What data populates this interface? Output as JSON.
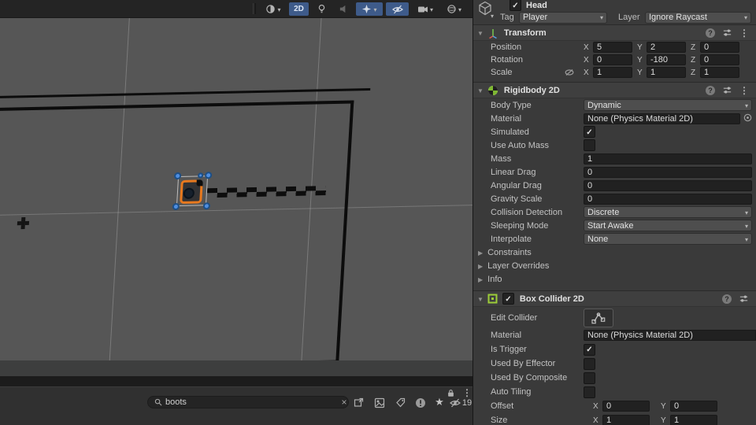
{
  "colors": {
    "selection_blue": "#3e5b8a",
    "sprite_orange": "#e8791e",
    "handle_blue": "#4f8ee0",
    "collider_green": "#9ccd38"
  },
  "scene": {
    "toolbar": {
      "mode_2d": "2D"
    }
  },
  "bottom_bar": {
    "search_value": "boots",
    "hidden_count": "19"
  },
  "inspector": {
    "axes": {
      "x": "X",
      "y": "Y",
      "z": "Z"
    },
    "header": {
      "name": "Head",
      "active_checked": true,
      "tag_label": "Tag",
      "tag_value": "Player",
      "layer_label": "Layer",
      "layer_value": "Ignore Raycast"
    },
    "transform": {
      "title": "Transform",
      "position": {
        "label": "Position",
        "x": "5",
        "y": "2",
        "z": "0"
      },
      "rotation": {
        "label": "Rotation",
        "x": "0",
        "y": "-180",
        "z": "0"
      },
      "scale": {
        "label": "Scale",
        "x": "1",
        "y": "1",
        "z": "1"
      }
    },
    "rigidbody": {
      "title": "Rigidbody 2D",
      "body_type_label": "Body Type",
      "body_type_value": "Dynamic",
      "material_label": "Material",
      "material_value": "None (Physics Material 2D)",
      "simulated_label": "Simulated",
      "simulated_checked": true,
      "use_auto_mass_label": "Use Auto Mass",
      "use_auto_mass_checked": false,
      "mass_label": "Mass",
      "mass_value": "1",
      "linear_drag_label": "Linear Drag",
      "linear_drag_value": "0",
      "angular_drag_label": "Angular Drag",
      "angular_drag_value": "0",
      "gravity_scale_label": "Gravity Scale",
      "gravity_scale_value": "0",
      "collision_detection_label": "Collision Detection",
      "collision_detection_value": "Discrete",
      "sleeping_mode_label": "Sleeping Mode",
      "sleeping_mode_value": "Start Awake",
      "interpolate_label": "Interpolate",
      "interpolate_value": "None",
      "foldout_constraints": "Constraints",
      "foldout_layer_overrides": "Layer Overrides",
      "foldout_info": "Info"
    },
    "box_collider": {
      "title": "Box Collider 2D",
      "enabled_checked": true,
      "edit_collider_label": "Edit Collider",
      "material_label": "Material",
      "material_value": "None (Physics Material 2D)",
      "is_trigger_label": "Is Trigger",
      "is_trigger_checked": true,
      "used_by_effector_label": "Used By Effector",
      "used_by_effector_checked": false,
      "used_by_composite_label": "Used By Composite",
      "used_by_composite_checked": false,
      "auto_tiling_label": "Auto Tiling",
      "auto_tiling_checked": false,
      "offset": {
        "label": "Offset",
        "x": "0",
        "y": "0"
      },
      "size": {
        "label": "Size",
        "x": "1",
        "y": "1"
      }
    }
  }
}
